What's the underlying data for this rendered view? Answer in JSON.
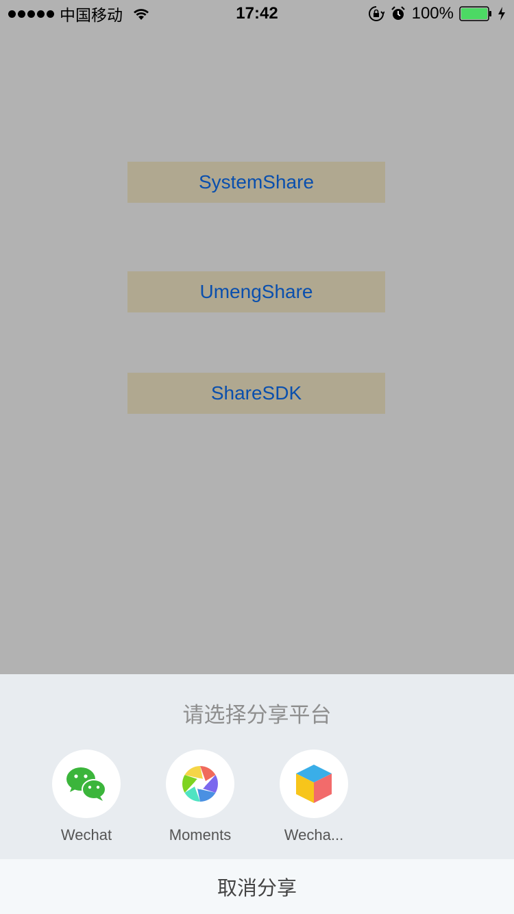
{
  "status_bar": {
    "carrier": "中国移动",
    "time": "17:42",
    "battery_percent": "100%",
    "battery_level": 1.0
  },
  "buttons": {
    "system_share": "SystemShare",
    "umeng_share": "UmengShare",
    "share_sdk": "ShareSDK"
  },
  "share_sheet": {
    "title": "请选择分享平台",
    "platforms": [
      {
        "label": "Wechat",
        "icon": "wechat-icon"
      },
      {
        "label": "Moments",
        "icon": "moments-icon"
      },
      {
        "label": "Wecha...",
        "icon": "wechat-favorite-icon"
      }
    ],
    "cancel_label": "取消分享"
  },
  "colors": {
    "background": "#b2b2b2",
    "button_bg": "#b0a890",
    "button_text": "#0a4fad",
    "sheet_bg": "#e8ecf0",
    "wechat_green": "#3bb53b",
    "battery_green": "#4cd964"
  }
}
